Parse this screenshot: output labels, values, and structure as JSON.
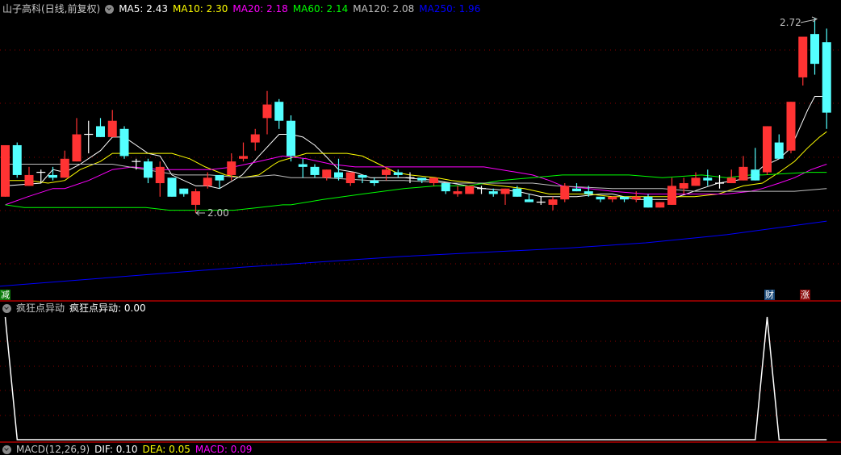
{
  "header": {
    "title": "山子高科(日线,前复权)",
    "ma": [
      {
        "label": "MA5: 2.43",
        "color": "#ffffff"
      },
      {
        "label": "MA10: 2.30",
        "color": "#ffff00"
      },
      {
        "label": "MA20: 2.18",
        "color": "#ff00ff"
      },
      {
        "label": "MA60: 2.14",
        "color": "#00ff00"
      },
      {
        "label": "MA120: 2.08",
        "color": "#c0c0c0"
      },
      {
        "label": "MA250: 1.96",
        "color": "#0000ff"
      }
    ]
  },
  "annotations": {
    "high_label": "2.72",
    "low_label": "2.00"
  },
  "tags": {
    "left": "减",
    "cai": "财",
    "zhang": "涨"
  },
  "indicator": {
    "title": "疯狂点异动",
    "value_label": "疯狂点异动: 0.00",
    "values": [
      1,
      0,
      0,
      0,
      0,
      0,
      0,
      0,
      0,
      0,
      0,
      0,
      0,
      0,
      0,
      0,
      0,
      0,
      0,
      0,
      0,
      0,
      0,
      0,
      0,
      0,
      0,
      0,
      0,
      0,
      0,
      0,
      0,
      0,
      0,
      0,
      0,
      0,
      0,
      0,
      0,
      0,
      0,
      0,
      0,
      0,
      0,
      0,
      0,
      0,
      0,
      0,
      0,
      0,
      0,
      0,
      0,
      0,
      0,
      0,
      0,
      0,
      0,
      0,
      1,
      0,
      0,
      0,
      0,
      0
    ]
  },
  "macd": {
    "title": "MACD(12,26,9)",
    "dif": "DIF: 0.10",
    "dea": "DEA: 0.05",
    "macd": "MACD: 0.09"
  },
  "colors": {
    "up": "#ff3333",
    "down": "#54ffff",
    "doji": "#ffffff",
    "grid": "#8b0000",
    "separator": "#b00000"
  },
  "chart_data": {
    "type": "candlestick",
    "ohlc": [
      [
        2.06,
        2.25,
        2.06,
        2.25
      ],
      [
        2.25,
        2.26,
        2.13,
        2.14
      ],
      [
        2.1,
        2.17,
        2.1,
        2.14
      ],
      [
        2.15,
        2.16,
        2.11,
        2.15
      ],
      [
        2.14,
        2.17,
        2.12,
        2.13
      ],
      [
        2.13,
        2.23,
        2.13,
        2.2
      ],
      [
        2.19,
        2.35,
        2.19,
        2.29
      ],
      [
        2.29,
        2.34,
        2.22,
        2.29
      ],
      [
        2.32,
        2.35,
        2.28,
        2.28
      ],
      [
        2.28,
        2.38,
        2.28,
        2.34
      ],
      [
        2.31,
        2.32,
        2.2,
        2.21
      ],
      [
        2.19,
        2.2,
        2.16,
        2.19
      ],
      [
        2.19,
        2.2,
        2.11,
        2.13
      ],
      [
        2.11,
        2.19,
        2.06,
        2.17
      ],
      [
        2.13,
        2.13,
        2.06,
        2.06
      ],
      [
        2.09,
        2.09,
        2.06,
        2.07
      ],
      [
        2.03,
        2.09,
        2.0,
        2.08
      ],
      [
        2.1,
        2.15,
        2.09,
        2.13
      ],
      [
        2.14,
        2.14,
        2.09,
        2.12
      ],
      [
        2.14,
        2.22,
        2.12,
        2.19
      ],
      [
        2.2,
        2.26,
        2.19,
        2.21
      ],
      [
        2.26,
        2.31,
        2.23,
        2.29
      ],
      [
        2.35,
        2.45,
        2.29,
        2.4
      ],
      [
        2.41,
        2.42,
        2.31,
        2.34
      ],
      [
        2.34,
        2.36,
        2.19,
        2.21
      ],
      [
        2.18,
        2.2,
        2.13,
        2.17
      ],
      [
        2.17,
        2.18,
        2.13,
        2.14
      ],
      [
        2.13,
        2.16,
        2.12,
        2.16
      ],
      [
        2.15,
        2.2,
        2.12,
        2.13
      ],
      [
        2.11,
        2.15,
        2.1,
        2.15
      ],
      [
        2.14,
        2.14,
        2.11,
        2.13
      ],
      [
        2.12,
        2.13,
        2.1,
        2.11
      ],
      [
        2.14,
        2.17,
        2.12,
        2.16
      ],
      [
        2.15,
        2.16,
        2.13,
        2.14
      ],
      [
        2.13,
        2.15,
        2.11,
        2.13
      ],
      [
        2.13,
        2.13,
        2.11,
        2.12
      ],
      [
        2.11,
        2.13,
        2.1,
        2.13
      ],
      [
        2.11,
        2.11,
        2.07,
        2.08
      ],
      [
        2.07,
        2.1,
        2.06,
        2.08
      ],
      [
        2.07,
        2.1,
        2.07,
        2.1
      ],
      [
        2.09,
        2.1,
        2.07,
        2.09
      ],
      [
        2.08,
        2.09,
        2.06,
        2.07
      ],
      [
        2.07,
        2.09,
        2.03,
        2.09
      ],
      [
        2.09,
        2.1,
        2.06,
        2.06
      ],
      [
        2.05,
        2.07,
        2.04,
        2.04
      ],
      [
        2.04,
        2.06,
        2.03,
        2.04
      ],
      [
        2.03,
        2.06,
        2.01,
        2.05
      ],
      [
        2.05,
        2.11,
        2.04,
        2.1
      ],
      [
        2.09,
        2.11,
        2.08,
        2.08
      ],
      [
        2.08,
        2.1,
        2.06,
        2.07
      ],
      [
        2.06,
        2.06,
        2.04,
        2.05
      ],
      [
        2.05,
        2.06,
        2.04,
        2.06
      ],
      [
        2.06,
        2.06,
        2.04,
        2.05
      ],
      [
        2.05,
        2.08,
        2.04,
        2.06
      ],
      [
        2.06,
        2.07,
        2.02,
        2.02
      ],
      [
        2.02,
        2.04,
        2.02,
        2.04
      ],
      [
        2.03,
        2.13,
        2.03,
        2.1
      ],
      [
        2.09,
        2.13,
        2.07,
        2.11
      ],
      [
        2.1,
        2.15,
        2.1,
        2.13
      ],
      [
        2.13,
        2.16,
        2.1,
        2.12
      ],
      [
        2.11,
        2.14,
        2.09,
        2.11
      ],
      [
        2.11,
        2.16,
        2.11,
        2.13
      ],
      [
        2.12,
        2.21,
        2.12,
        2.17
      ],
      [
        2.16,
        2.24,
        2.12,
        2.12
      ],
      [
        2.15,
        2.32,
        2.14,
        2.32
      ],
      [
        2.26,
        2.29,
        2.2,
        2.2
      ],
      [
        2.23,
        2.41,
        2.22,
        2.41
      ],
      [
        2.5,
        2.65,
        2.47,
        2.65
      ],
      [
        2.66,
        2.72,
        2.51,
        2.55
      ],
      [
        2.63,
        2.68,
        2.31,
        2.37
      ]
    ],
    "ma_series": [
      {
        "name": "MA5",
        "color": "#ffffff",
        "points": [
          [
            0,
            2.1
          ],
          [
            3,
            2.11
          ],
          [
            4,
            2.16
          ],
          [
            5,
            2.15
          ],
          [
            6.3,
            2.18
          ],
          [
            8,
            2.23
          ],
          [
            9,
            2.28
          ],
          [
            10,
            2.28
          ],
          [
            11,
            2.25
          ],
          [
            12,
            2.22
          ],
          [
            13,
            2.21
          ],
          [
            14,
            2.14
          ],
          [
            16,
            2.1
          ],
          [
            17,
            2.1
          ],
          [
            18,
            2.09
          ],
          [
            19.9,
            2.14
          ],
          [
            21.3,
            2.21
          ],
          [
            23,
            2.29
          ],
          [
            24,
            2.29
          ],
          [
            25,
            2.28
          ],
          [
            26,
            2.25
          ],
          [
            26.7,
            2.22
          ],
          [
            28,
            2.16
          ],
          [
            29.4,
            2.15
          ],
          [
            30.7,
            2.13
          ],
          [
            33.5,
            2.13
          ],
          [
            36.2,
            2.12
          ],
          [
            37.5,
            2.11
          ],
          [
            40.2,
            2.09
          ],
          [
            43,
            2.08
          ],
          [
            45,
            2.06
          ],
          [
            46.8,
            2.06
          ],
          [
            48,
            2.06
          ],
          [
            50,
            2.07
          ],
          [
            51,
            2.07
          ],
          [
            53,
            2.05
          ],
          [
            54.8,
            2.05
          ],
          [
            55.8,
            2.05
          ],
          [
            57.2,
            2.07
          ],
          [
            58.5,
            2.09
          ],
          [
            59.9,
            2.11
          ],
          [
            61.3,
            2.12
          ],
          [
            62.6,
            2.13
          ],
          [
            63.6,
            2.17
          ],
          [
            65,
            2.2
          ],
          [
            66,
            2.24
          ],
          [
            67.4,
            2.38
          ],
          [
            68,
            2.43
          ],
          [
            69,
            2.43
          ]
        ]
      },
      {
        "name": "MA10",
        "color": "#ffff00",
        "points": [
          [
            0,
            2.12
          ],
          [
            2,
            2.12
          ],
          [
            3.6,
            2.11
          ],
          [
            5,
            2.12
          ],
          [
            6.3,
            2.16
          ],
          [
            8,
            2.19
          ],
          [
            9,
            2.22
          ],
          [
            10,
            2.22
          ],
          [
            11,
            2.22
          ],
          [
            13,
            2.22
          ],
          [
            14,
            2.22
          ],
          [
            15.5,
            2.2
          ],
          [
            16.8,
            2.17
          ],
          [
            18.5,
            2.14
          ],
          [
            19.9,
            2.13
          ],
          [
            21.3,
            2.14
          ],
          [
            22.6,
            2.18
          ],
          [
            23,
            2.19
          ],
          [
            25.3,
            2.22
          ],
          [
            26.7,
            2.22
          ],
          [
            28.7,
            2.22
          ],
          [
            30,
            2.21
          ],
          [
            31.4,
            2.18
          ],
          [
            32.8,
            2.15
          ],
          [
            34,
            2.14
          ],
          [
            36.2,
            2.13
          ],
          [
            37.5,
            2.12
          ],
          [
            39.6,
            2.11
          ],
          [
            41.6,
            2.1
          ],
          [
            43.6,
            2.09
          ],
          [
            45.7,
            2.07
          ],
          [
            46.8,
            2.07
          ],
          [
            49,
            2.07
          ],
          [
            51,
            2.06
          ],
          [
            53.8,
            2.06
          ],
          [
            55.8,
            2.06
          ],
          [
            57.9,
            2.06
          ],
          [
            59.9,
            2.07
          ],
          [
            62,
            2.1
          ],
          [
            63.6,
            2.11
          ],
          [
            65,
            2.15
          ],
          [
            66.3,
            2.19
          ],
          [
            67.4,
            2.24
          ],
          [
            68.4,
            2.28
          ],
          [
            69,
            2.3
          ]
        ]
      },
      {
        "name": "MA20",
        "color": "#ff00ff",
        "points": [
          [
            0,
            2.03
          ],
          [
            1.9,
            2.06
          ],
          [
            4,
            2.09
          ],
          [
            5,
            2.09
          ],
          [
            7,
            2.12
          ],
          [
            9,
            2.16
          ],
          [
            10.7,
            2.17
          ],
          [
            13,
            2.16
          ],
          [
            15.2,
            2.16
          ],
          [
            17.2,
            2.16
          ],
          [
            19.2,
            2.17
          ],
          [
            21.3,
            2.19
          ],
          [
            23.3,
            2.21
          ],
          [
            25.3,
            2.2
          ],
          [
            27.4,
            2.18
          ],
          [
            29.4,
            2.17
          ],
          [
            32.1,
            2.17
          ],
          [
            34.8,
            2.17
          ],
          [
            37.5,
            2.17
          ],
          [
            40.2,
            2.17
          ],
          [
            43,
            2.15
          ],
          [
            44.3,
            2.14
          ],
          [
            45.7,
            2.12
          ],
          [
            46.8,
            2.1
          ],
          [
            49,
            2.09
          ],
          [
            51,
            2.08
          ],
          [
            53.8,
            2.07
          ],
          [
            55.8,
            2.07
          ],
          [
            57.9,
            2.07
          ],
          [
            60.6,
            2.07
          ],
          [
            62.6,
            2.08
          ],
          [
            63.6,
            2.09
          ],
          [
            65,
            2.11
          ],
          [
            66.3,
            2.13
          ],
          [
            67.7,
            2.16
          ],
          [
            69,
            2.18
          ]
        ]
      },
      {
        "name": "MA60",
        "color": "#00ff00",
        "points": [
          [
            0,
            2.03
          ],
          [
            1.6,
            2.02
          ],
          [
            3.6,
            2.02
          ],
          [
            6.3,
            2.02
          ],
          [
            8.4,
            2.02
          ],
          [
            11.8,
            2.02
          ],
          [
            13.8,
            2.01
          ],
          [
            16.5,
            2.01
          ],
          [
            19.2,
            2.01
          ],
          [
            21.3,
            2.02
          ],
          [
            23.3,
            2.03
          ],
          [
            24,
            2.03
          ],
          [
            26.7,
            2.05
          ],
          [
            30,
            2.07
          ],
          [
            33.5,
            2.09
          ],
          [
            36.2,
            2.1
          ],
          [
            38.9,
            2.1
          ],
          [
            41.6,
            2.12
          ],
          [
            44.3,
            2.13
          ],
          [
            46.8,
            2.14
          ],
          [
            49,
            2.14
          ],
          [
            52.4,
            2.14
          ],
          [
            55.2,
            2.13
          ],
          [
            58.5,
            2.14
          ],
          [
            60.6,
            2.13
          ],
          [
            62.6,
            2.14
          ],
          [
            63.6,
            2.14
          ],
          [
            67.4,
            2.15
          ],
          [
            69,
            2.15
          ]
        ]
      },
      {
        "name": "MA120",
        "color": "#c0c0c0",
        "points": [
          [
            0,
            2.18
          ],
          [
            3.6,
            2.18
          ],
          [
            6.3,
            2.18
          ],
          [
            9,
            2.18
          ],
          [
            11.8,
            2.16
          ],
          [
            14.5,
            2.14
          ],
          [
            17.2,
            2.14
          ],
          [
            19.9,
            2.13
          ],
          [
            22.6,
            2.14
          ],
          [
            24,
            2.13
          ],
          [
            26.7,
            2.13
          ],
          [
            30.7,
            2.12
          ],
          [
            33.5,
            2.12
          ],
          [
            37.5,
            2.11
          ],
          [
            40.2,
            2.11
          ],
          [
            44.3,
            2.11
          ],
          [
            46.3,
            2.1
          ],
          [
            51,
            2.09
          ],
          [
            55.2,
            2.09
          ],
          [
            57.9,
            2.08
          ],
          [
            62.6,
            2.08
          ],
          [
            63.6,
            2.08
          ],
          [
            66.3,
            2.08
          ],
          [
            69,
            2.09
          ]
        ]
      },
      {
        "name": "MA250",
        "color": "#0000ff",
        "points": [
          [
            -0.44,
            1.73
          ],
          [
            19.9,
            1.8
          ],
          [
            33.5,
            1.84
          ],
          [
            47,
            1.87
          ],
          [
            53.8,
            1.89
          ],
          [
            60.6,
            1.92
          ],
          [
            69,
            1.97
          ]
        ]
      }
    ]
  }
}
